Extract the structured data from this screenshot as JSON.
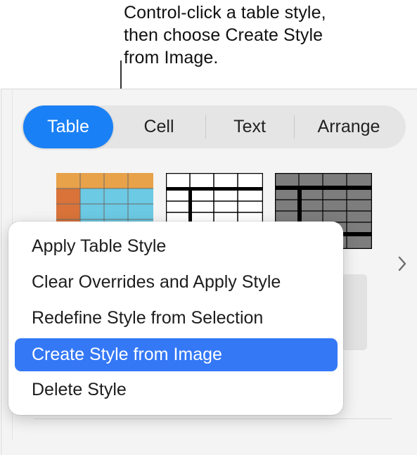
{
  "callout": {
    "lines": [
      "Control-click a table style,",
      "then choose Create Style",
      "from Image."
    ]
  },
  "tabs": [
    {
      "label": "Table",
      "active": true
    },
    {
      "label": "Cell",
      "active": false
    },
    {
      "label": "Text",
      "active": false
    },
    {
      "label": "Arrange",
      "active": false
    }
  ],
  "table_styles": [
    {
      "name": "orange-blue",
      "header_color": "#e8a24a",
      "first_column_color": "#d9733a",
      "body_color": "#6ccae4"
    },
    {
      "name": "black-white",
      "header_color": "#ffffff",
      "body_color": "#ffffff",
      "line_color": "#000000"
    },
    {
      "name": "gray",
      "header_color": "#7d7d7d",
      "body_color": "#7d7d7d",
      "line_color": "#000000"
    }
  ],
  "context_menu": {
    "items": [
      {
        "label": "Apply Table Style",
        "highlighted": false
      },
      {
        "label": "Clear Overrides and Apply Style",
        "highlighted": false
      },
      {
        "label": "Redefine Style from Selection",
        "highlighted": false
      },
      {
        "label": "Create Style from Image",
        "highlighted": true
      },
      {
        "label": "Delete Style",
        "highlighted": false
      }
    ]
  },
  "colors": {
    "accent": "#1a80f5",
    "menu_highlight": "#3478f6"
  },
  "icons": {
    "next_styles": "chevron-right-icon"
  }
}
